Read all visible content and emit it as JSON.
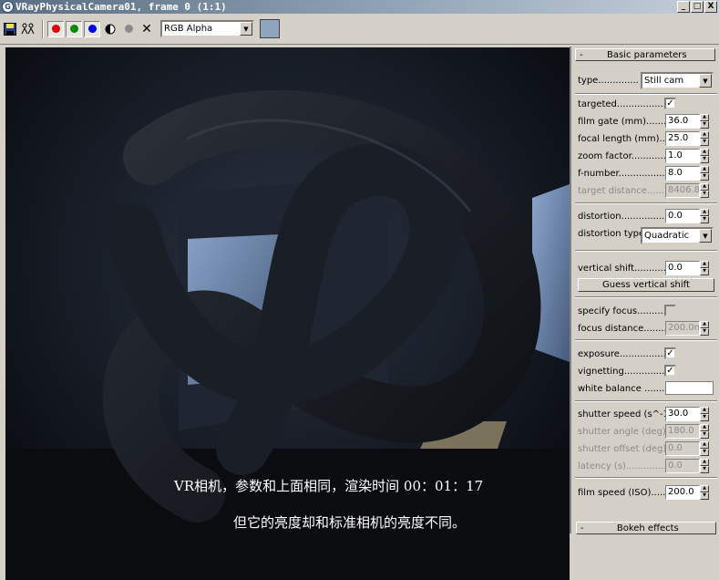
{
  "window": {
    "title": "VRayPhysicalCamera01, frame 0 (1:1)",
    "icon_letter": "G",
    "controls": {
      "minimize": "_",
      "maximize": "□",
      "close": "X"
    }
  },
  "toolbar": {
    "icons": [
      "save-icon",
      "clone-icon",
      "red-channel-icon",
      "green-channel-icon",
      "blue-channel-icon",
      "mono-icon",
      "alpha-dot-icon",
      "clear-icon"
    ],
    "channel_select": "RGB Alpha",
    "swatch_color": "#8fa4bd",
    "clear_glyph": "✕"
  },
  "viewport": {
    "caption_line1": "VR相机，参数和上面相同，渲染时间 00：01：17",
    "caption_line2": "但它的亮度却和标准相机的亮度不同。"
  },
  "panel": {
    "rollout_title": "Basic parameters",
    "collapse_glyph": "-",
    "type_label": "type..............",
    "type_value": "Still cam",
    "targeted_label": "targeted...................",
    "targeted_checked": true,
    "film_gate_label": "film gate (mm)..........",
    "film_gate_value": "36.0",
    "focal_length_label": "focal length (mm).....",
    "focal_length_value": "25.0",
    "zoom_factor_label": "zoom factor............",
    "zoom_factor_value": "1.0",
    "f_number_label": "f-number..................",
    "f_number_value": "8.0",
    "target_distance_label": "target distance..........",
    "target_distance_value": "8406.8",
    "distortion_label": "distortion.................",
    "distortion_value": "0.0",
    "distortion_type_label": "distortion type.",
    "distortion_type_value": "Quadratic",
    "vertical_shift_label": "vertical shift.............",
    "vertical_shift_value": "0.0",
    "guess_button": "Guess vertical shift",
    "specify_focus_label": "specify focus..........",
    "specify_focus_checked": false,
    "focus_distance_label": "focus distance.........",
    "focus_distance_value": "200.0m",
    "exposure_label": "exposure..................",
    "exposure_checked": true,
    "vignetting_label": "vignetting.................",
    "vignetting_checked": true,
    "white_balance_label": "white balance .........",
    "white_balance_color": "#ffffff",
    "shutter_speed_label": "shutter speed (s^-1).",
    "shutter_speed_value": "30.0",
    "shutter_angle_label": "shutter angle (deg)..",
    "shutter_angle_value": "180.0",
    "shutter_offset_label": "shutter offset (deg)..",
    "shutter_offset_value": "0.0",
    "latency_label": "latency (s)..............",
    "latency_value": "0.0",
    "film_speed_label": "film speed (ISO).......",
    "film_speed_value": "200.0",
    "bokeh_title": "Bokeh effects",
    "check_glyph": "✓",
    "dropdown_glyph": "▼",
    "spin_up": "▲",
    "spin_down": "▼"
  }
}
